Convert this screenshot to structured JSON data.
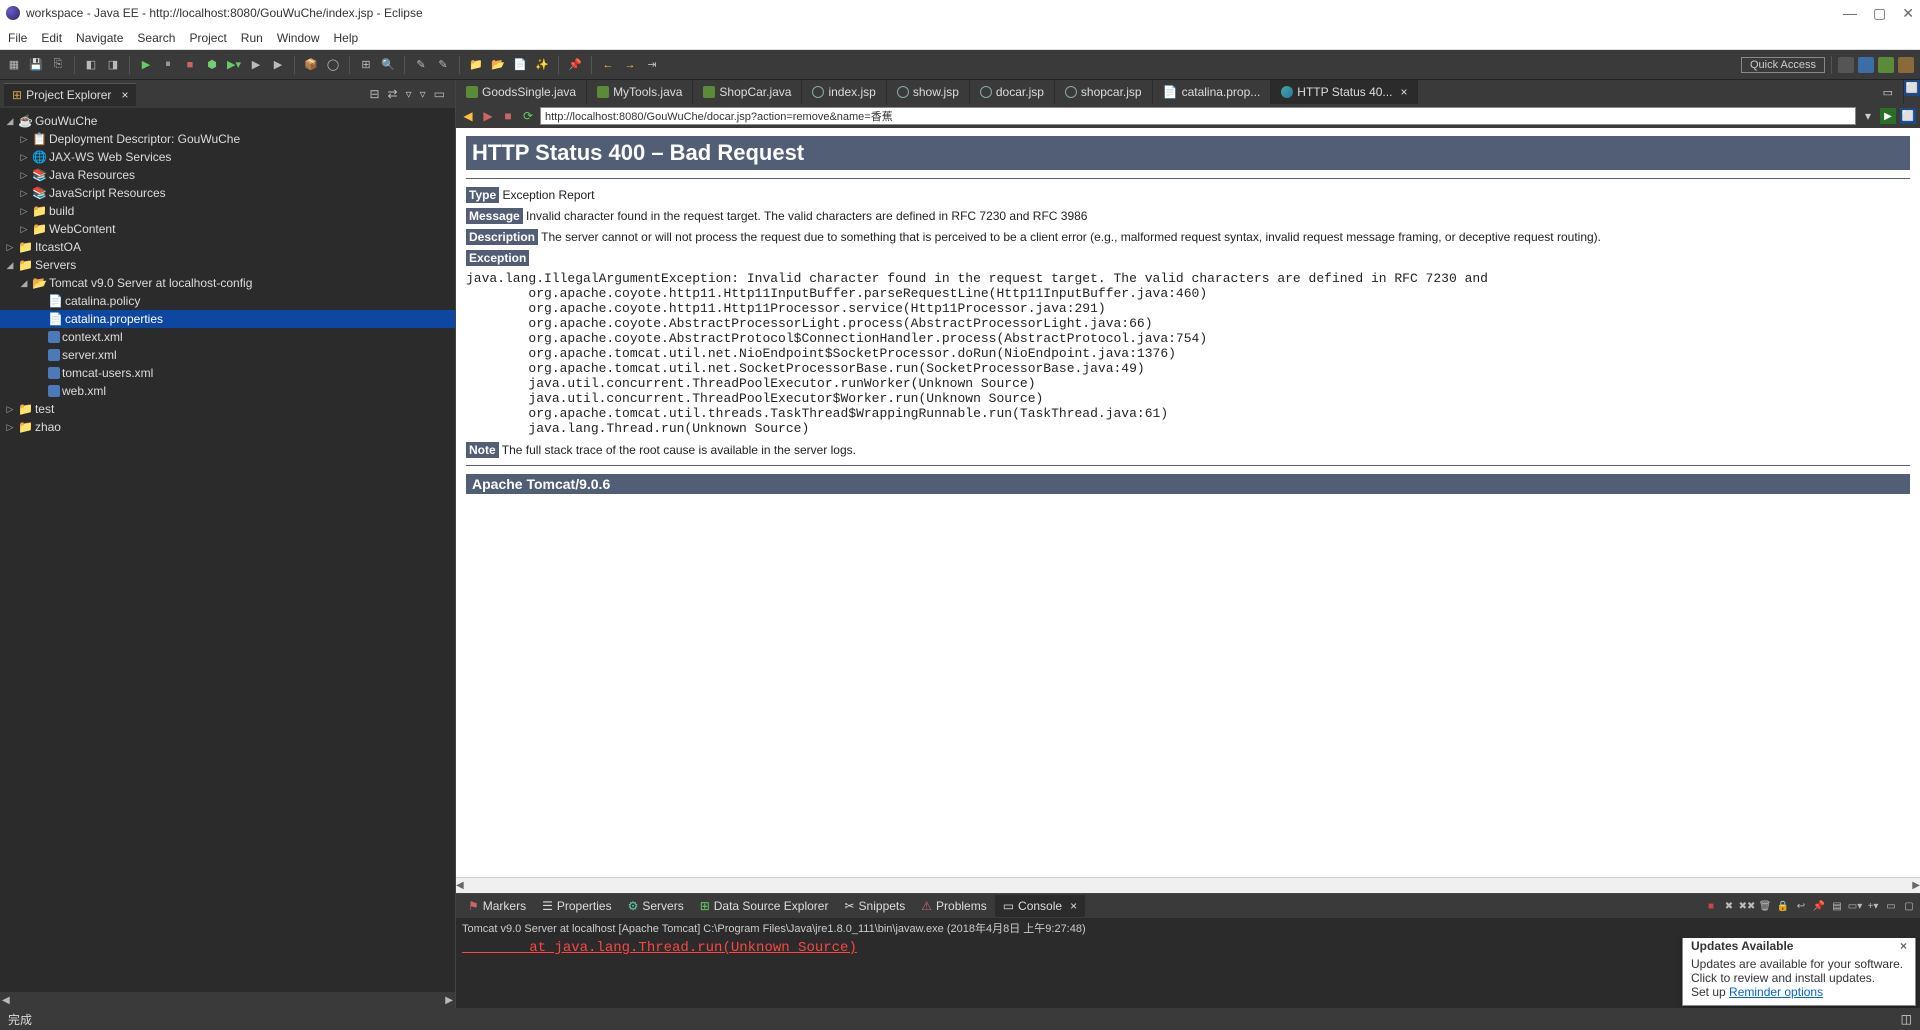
{
  "titlebar": {
    "text": "workspace - Java EE - http://localhost:8080/GouWuChe/index.jsp - Eclipse",
    "min": "—",
    "max": "▢",
    "close": "✕"
  },
  "menu": {
    "file": "File",
    "edit": "Edit",
    "navigate": "Navigate",
    "search": "Search",
    "project": "Project",
    "run": "Run",
    "window": "Window",
    "help": "Help"
  },
  "toolbar": {
    "quick_access": "Quick Access"
  },
  "explorer": {
    "tab": "Project Explorer",
    "nodes": {
      "gouwuche": "GouWuChe",
      "deployment": "Deployment Descriptor: GouWuChe",
      "jaxws": "JAX-WS Web Services",
      "javares": "Java Resources",
      "jsres": "JavaScript Resources",
      "build": "build",
      "webcontent": "WebContent",
      "itcastoa": "ItcastOA",
      "servers": "Servers",
      "tomcat": "Tomcat v9.0 Server at localhost-config",
      "catalina_policy": "catalina.policy",
      "catalina_props": "catalina.properties",
      "context_xml": "context.xml",
      "server_xml": "server.xml",
      "tomcat_users": "tomcat-users.xml",
      "web_xml": "web.xml",
      "test": "test",
      "zhao": "zhao"
    }
  },
  "editor_tabs": [
    "GoodsSingle.java",
    "MyTools.java",
    "ShopCar.java",
    "index.jsp",
    "show.jsp",
    "docar.jsp",
    "shopcar.jsp",
    "catalina.prop...",
    "HTTP Status 40..."
  ],
  "browser": {
    "url": "http://localhost:8080/GouWuChe/docar.jsp?action=remove&name=香蕉"
  },
  "page": {
    "h1": "HTTP Status 400 – Bad Request",
    "type_lbl": "Type",
    "type_txt": " Exception Report",
    "msg_lbl": "Message",
    "msg_txt": " Invalid character found in the request target. The valid characters are defined in RFC 7230 and RFC 3986",
    "desc_lbl": "Description",
    "desc_txt": " The server cannot or will not process the request due to something that is perceived to be a client error (e.g., malformed request syntax, invalid request message framing, or deceptive request routing).",
    "exc_lbl": "Exception",
    "stack": "java.lang.IllegalArgumentException: Invalid character found in the request target. The valid characters are defined in RFC 7230 and\n        org.apache.coyote.http11.Http11InputBuffer.parseRequestLine(Http11InputBuffer.java:460)\n        org.apache.coyote.http11.Http11Processor.service(Http11Processor.java:291)\n        org.apache.coyote.AbstractProcessorLight.process(AbstractProcessorLight.java:66)\n        org.apache.coyote.AbstractProtocol$ConnectionHandler.process(AbstractProtocol.java:754)\n        org.apache.tomcat.util.net.NioEndpoint$SocketProcessor.doRun(NioEndpoint.java:1376)\n        org.apache.tomcat.util.net.SocketProcessorBase.run(SocketProcessorBase.java:49)\n        java.util.concurrent.ThreadPoolExecutor.runWorker(Unknown Source)\n        java.util.concurrent.ThreadPoolExecutor$Worker.run(Unknown Source)\n        org.apache.tomcat.util.threads.TaskThread$WrappingRunnable.run(TaskThread.java:61)\n        java.lang.Thread.run(Unknown Source)",
    "note_lbl": "Note",
    "note_txt": " The full stack trace of the root cause is available in the server logs.",
    "footer": "Apache Tomcat/9.0.6"
  },
  "bottom": {
    "tabs": {
      "markers": "Markers",
      "properties": "Properties",
      "servers": "Servers",
      "dse": "Data Source Explorer",
      "snippets": "Snippets",
      "problems": "Problems",
      "console": "Console"
    },
    "console_head": "Tomcat v9.0 Server at localhost [Apache Tomcat] C:\\Program Files\\Java\\jre1.8.0_111\\bin\\javaw.exe (2018年4月8日 上午9:27:48)",
    "console_line": "        at java.lang.Thread.run(Unknown Source)"
  },
  "status": {
    "done": "完成"
  },
  "updates": {
    "title": "Updates Available",
    "body": "Updates are available for your software. Click to review and install updates.",
    "setup": "Set up ",
    "link": "Reminder options"
  }
}
